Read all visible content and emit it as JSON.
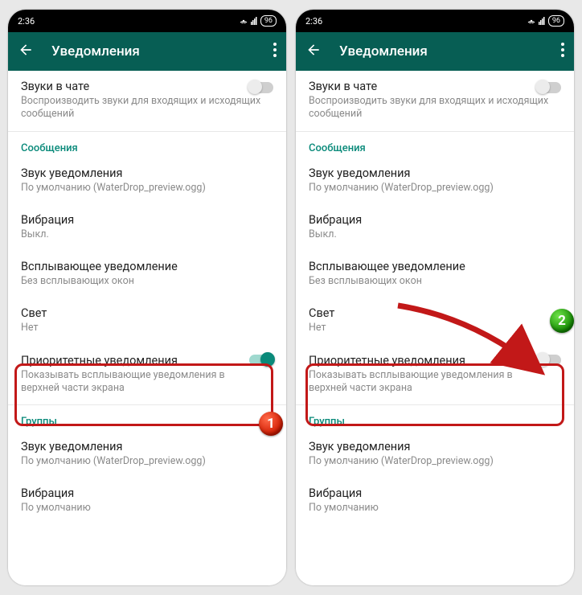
{
  "statusbar": {
    "time": "2:36",
    "battery": "96"
  },
  "appbar": {
    "title": "Уведомления"
  },
  "rows": {
    "chat_sounds": {
      "title": "Звуки в чате",
      "sub": "Воспроизводить звуки для входящих и исходящих сообщений"
    },
    "section_messages": "Сообщения",
    "notif_sound": {
      "title": "Звук уведомления",
      "sub": "По умолчанию (WaterDrop_preview.ogg)"
    },
    "vibration": {
      "title": "Вибрация",
      "sub": "Выкл."
    },
    "popup": {
      "title": "Всплывающее уведомление",
      "sub": "Без всплывающих окон"
    },
    "light": {
      "title": "Свет",
      "sub": "Нет"
    },
    "priority": {
      "title": "Приоритетные уведомления",
      "sub": "Показывать всплывающие уведомления в верхней части экрана"
    },
    "section_groups": "Группы",
    "group_sound": {
      "title": "Звук уведомления",
      "sub": "По умолчанию (WaterDrop_preview.ogg)"
    },
    "group_vib": {
      "title": "Вибрация",
      "sub": "По умолчанию"
    }
  },
  "badges": {
    "one": "1",
    "two": "2"
  }
}
